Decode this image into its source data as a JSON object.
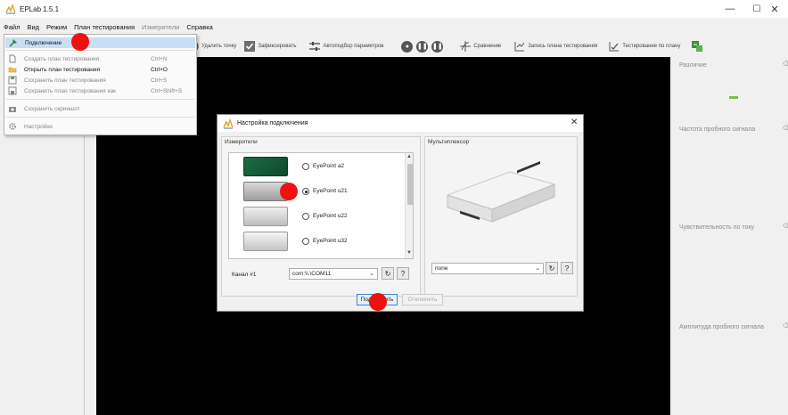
{
  "window": {
    "title": "EPLab 1.5.1",
    "minimize": "—",
    "maximize": "☐",
    "close": "✕"
  },
  "menubar": {
    "items": [
      {
        "label": "Файл",
        "disabled": false
      },
      {
        "label": "Вид",
        "disabled": false
      },
      {
        "label": "Режим",
        "disabled": false
      },
      {
        "label": "План тестирования",
        "disabled": false
      },
      {
        "label": "Измерители",
        "disabled": true
      },
      {
        "label": "Справка",
        "disabled": false
      }
    ]
  },
  "file_menu": {
    "connect": "Подключение",
    "new_plan": "Создать план тестирования",
    "new_plan_shortcut": "Ctrl+N",
    "open_plan": "Открыть план тестирования",
    "open_plan_shortcut": "Ctrl+O",
    "save_plan": "Сохранить план тестирования",
    "save_plan_shortcut": "Ctrl+S",
    "save_plan_as": "Сохранить план тестирования как",
    "save_plan_as_shortcut": "Ctrl+Shift+S",
    "screenshot": "Сохранить скриншот",
    "settings": "Настройки"
  },
  "toolbar": {
    "delete_point": "Удалить точку",
    "fix": "Зафиксировать",
    "auto_params": "Автоподбор параметров",
    "compare": "Сравнение",
    "record_plan": "Запись плана тестирования",
    "test_by_plan": "Тестирование по плану"
  },
  "right_panel": {
    "difference": "Различие",
    "probe_frequency": "Частота пробного сигнала",
    "current_sensitivity": "Чувствительность по току",
    "probe_amplitude": "Амплитуда пробного сигнала"
  },
  "dialog": {
    "title": "Настройка подключения",
    "meters_group": "Измерители",
    "mux_group": "Мультиплексор",
    "devices": [
      {
        "label": "EyePoint a2",
        "checked": false
      },
      {
        "label": "EyePoint u21",
        "checked": true
      },
      {
        "label": "EyePoint u22",
        "checked": false
      },
      {
        "label": "EyePoint u32",
        "checked": false
      }
    ],
    "channel_label": "Канал #1",
    "channel_value": "com:\\\\.\\COM11",
    "mux_value": "none",
    "refresh_glyph": "↻",
    "help_glyph": "?",
    "connect_button": "Подключить",
    "disconnect_button": "Отключить"
  },
  "colors": {
    "canvas": "#000000",
    "highlight": "#c9def5",
    "marker": "#f01010",
    "accent_green": "#7bbf3d"
  }
}
